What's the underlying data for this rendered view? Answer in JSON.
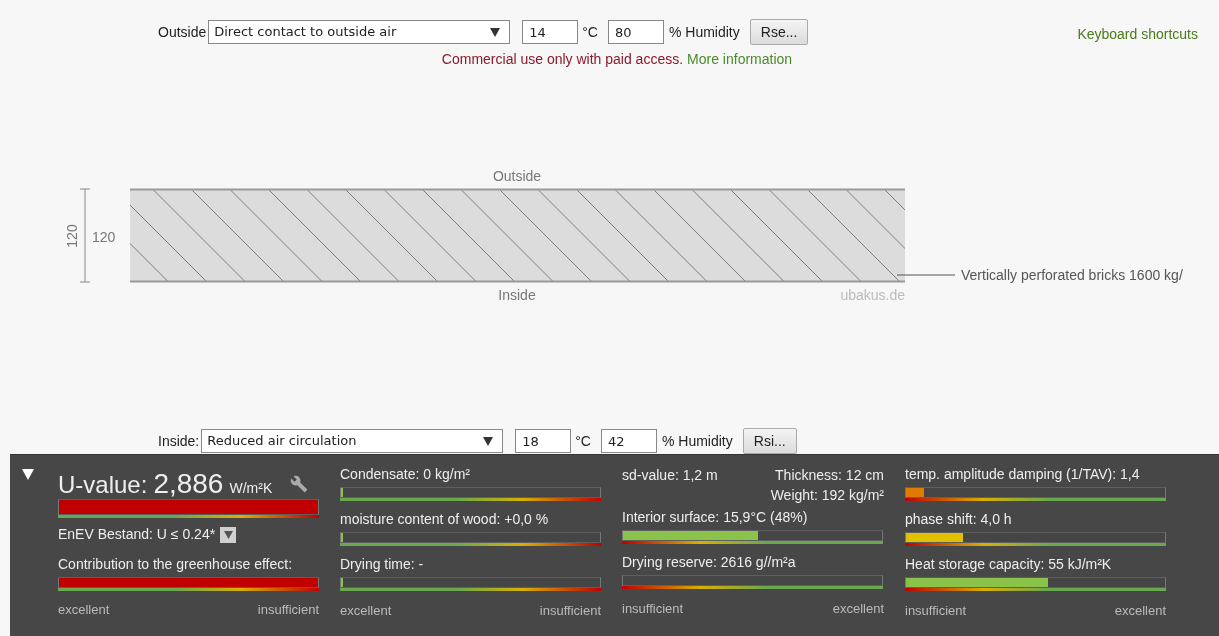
{
  "outside": {
    "label": "Outside",
    "select": "Direct contact to outside air",
    "temperature": "14",
    "temp_unit": "°C",
    "humidity": "80",
    "humidity_unit": "% Humidity",
    "button": "Rse..."
  },
  "keyboard_shortcuts": "Keyboard shortcuts",
  "notice": {
    "text": "Commercial use only with paid access.",
    "link": "More information"
  },
  "diagram": {
    "outside_label": "Outside",
    "inside_label": "Inside",
    "dimension_rotated": "120",
    "dimension": "120",
    "credit": "ubakus.de",
    "layer_label": "Vertically perforated bricks 1600 kg/"
  },
  "inside": {
    "label": "Inside:",
    "select": "Reduced air circulation",
    "temperature": "18",
    "temp_unit": "°C",
    "humidity": "42",
    "humidity_unit": "% Humidity",
    "button": "Rsi..."
  },
  "results": {
    "expanded": true,
    "u_value": {
      "label": "U-value:",
      "value": "2,886",
      "unit": "W/m²K",
      "level": 1,
      "color": "#c00000"
    },
    "enev": "EnEV Bestand: U ≤ 0.24*",
    "columns": [
      {
        "kind": "lowgood",
        "scale": [
          "excellent",
          "insufficient"
        ],
        "items": [
          {
            "kind": "meter",
            "label": "Contribution to the greenhouse effect:",
            "level": 1,
            "color": "#c00000"
          }
        ]
      },
      {
        "kind": "lowgood",
        "scale": [
          "excellent",
          "insufficient"
        ],
        "items": [
          {
            "kind": "meter",
            "label": "Condensate: 0 kg/m²",
            "level": 0.004,
            "color": "#8bc34a"
          },
          {
            "kind": "meter",
            "label": "moisture content of wood: +0,0 %",
            "level": 0.004,
            "color": "#8bc34a"
          },
          {
            "kind": "meter",
            "label": "Drying time: -",
            "level": 0.004,
            "color": "#8bc34a"
          }
        ]
      },
      {
        "kind": "highgood",
        "scale": [
          "insufficient",
          "excellent"
        ],
        "items": [
          {
            "kind": "facts",
            "left": "sd-value: 1,2 m",
            "right": [
              "Thickness: 12 cm",
              "Weight: 192 kg/m²"
            ]
          },
          {
            "kind": "meter",
            "label": "Interior surface: 15,9°C (48%)",
            "level": 0.52,
            "color": "#8bc34a"
          },
          {
            "kind": "meter",
            "label": "Drying reserve: 2616 g//m²a"
          }
        ]
      },
      {
        "kind": "highgood",
        "scale": [
          "insufficient",
          "excellent"
        ],
        "items": [
          {
            "kind": "meter",
            "label": "temp. amplitude damping (1/TAV): 1,4",
            "level": 0.07,
            "color": "#e07b00"
          },
          {
            "kind": "meter",
            "label": "phase shift: 4,0 h",
            "level": 0.22,
            "color": "#e0c000"
          },
          {
            "kind": "meter",
            "label": "Heat storage capacity: 55 kJ/m²K",
            "level": 0.55,
            "color": "#8bc34a"
          }
        ]
      }
    ]
  }
}
